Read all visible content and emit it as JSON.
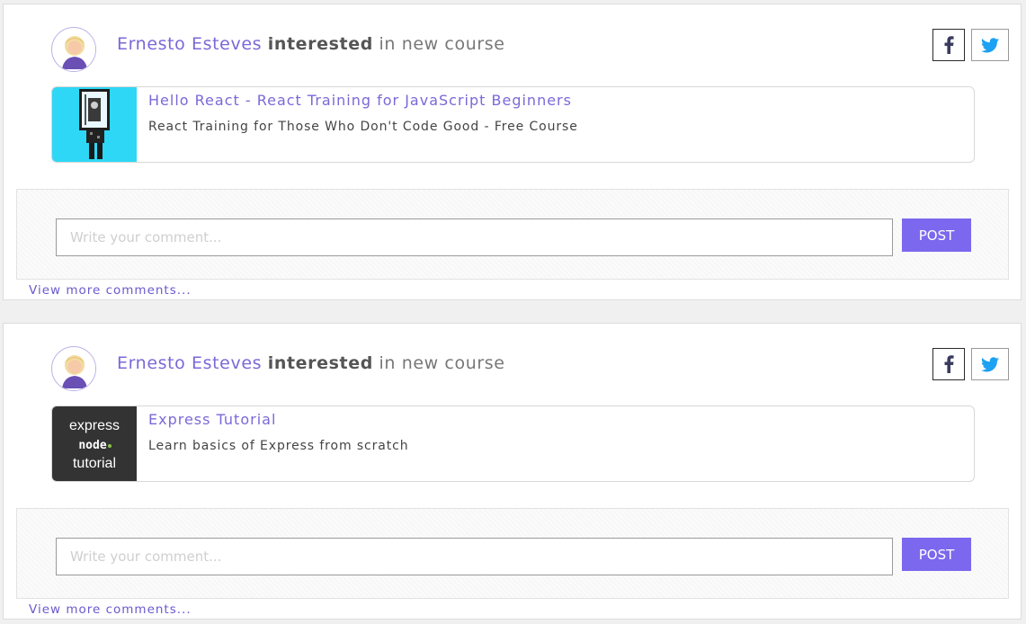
{
  "posts": [
    {
      "author": "Ernesto Esteves",
      "action": "interested",
      "context": "in new course",
      "social": {
        "facebook_icon": "facebook-f-icon",
        "twitter_icon": "twitter-bird-icon"
      },
      "course": {
        "title": "Hello React - React Training for JavaScript Beginners",
        "description": "React Training for Those Who Don't Code Good - Free Course",
        "thumbnail": "react-course-thumbnail"
      },
      "comment_placeholder": "Write your comment...",
      "post_label": "POST",
      "more_comments": "View more comments..."
    },
    {
      "author": "Ernesto Esteves",
      "action": "interested",
      "context": "in new course",
      "social": {
        "facebook_icon": "facebook-f-icon",
        "twitter_icon": "twitter-bird-icon"
      },
      "course": {
        "title": "Express Tutorial",
        "description": "Learn basics of Express from scratch",
        "thumbnail": "express-course-thumbnail",
        "thumb_lines": [
          "express",
          "node",
          "tutorial"
        ]
      },
      "comment_placeholder": "Write your comment...",
      "post_label": "POST",
      "more_comments": "View more comments..."
    }
  ],
  "colors": {
    "accent": "#7b68ee",
    "link": "#7b68d8",
    "twitter": "#1da1f2",
    "react_thumb_bg": "#2ed7f5",
    "express_thumb_bg": "#333333"
  }
}
